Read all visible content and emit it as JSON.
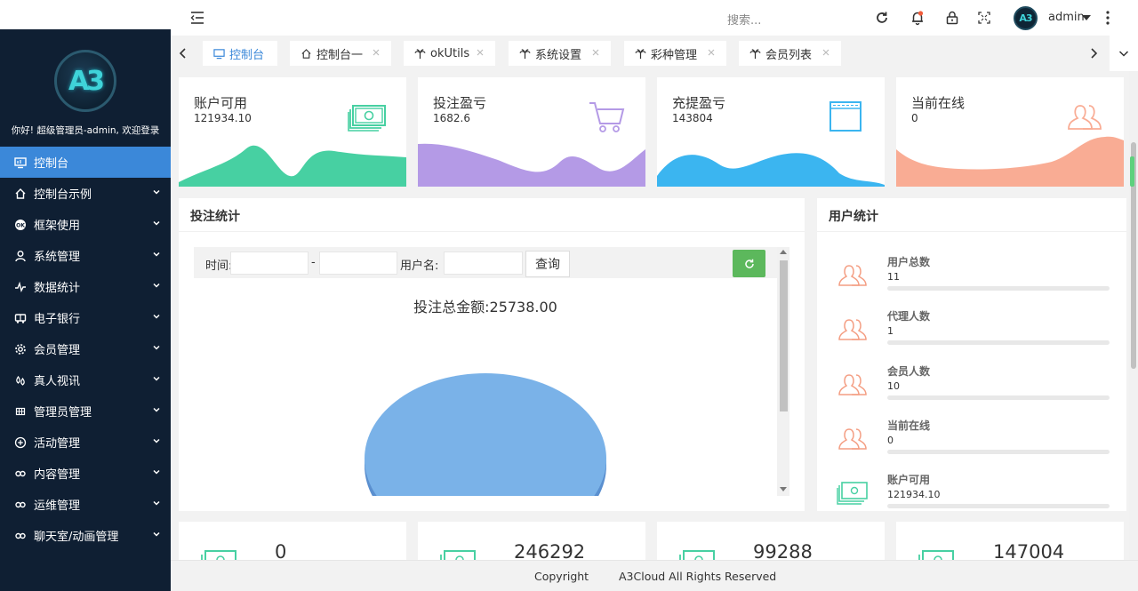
{
  "app": {
    "logo_text": "A3",
    "welcome": "你好! 超级管理员-admin, 欢迎登录"
  },
  "sidebar": {
    "items": [
      {
        "label": "控制台",
        "icon": "monitor-icon",
        "active": true
      },
      {
        "label": "控制台示例",
        "icon": "home-icon"
      },
      {
        "label": "框架使用",
        "icon": "ok-icon"
      },
      {
        "label": "系统管理",
        "icon": "user-icon"
      },
      {
        "label": "数据统计",
        "icon": "pulse-icon"
      },
      {
        "label": "电子银行",
        "icon": "bus-icon"
      },
      {
        "label": "会员管理",
        "icon": "gear-icon"
      },
      {
        "label": "真人视讯",
        "icon": "drops-icon"
      },
      {
        "label": "管理员管理",
        "icon": "grid-icon"
      },
      {
        "label": "活动管理",
        "icon": "plus-circle-icon"
      },
      {
        "label": "内容管理",
        "icon": "link-icon"
      },
      {
        "label": "运维管理",
        "icon": "link-icon"
      },
      {
        "label": "聊天室/动画管理",
        "icon": "link-icon"
      }
    ]
  },
  "header": {
    "search_placeholder": "搜索...",
    "username": "admin",
    "avatar_text": "A3"
  },
  "tabs": [
    {
      "label": "控制台",
      "icon": "monitor-icon",
      "active": true,
      "closable": false
    },
    {
      "label": "控制台一",
      "icon": "home-icon",
      "closable": true
    },
    {
      "label": "okUtils",
      "icon": "palm-icon",
      "closable": true
    },
    {
      "label": "系统设置",
      "icon": "palm-icon",
      "closable": true
    },
    {
      "label": "彩种管理",
      "icon": "palm-icon",
      "closable": true
    },
    {
      "label": "会员列表",
      "icon": "palm-icon",
      "closable": true
    }
  ],
  "stat_cards": [
    {
      "title": "账户可用",
      "value": "121934.10",
      "icon": "money-icon",
      "color": "#47d0a2"
    },
    {
      "title": "投注盈亏",
      "value": "1682.6",
      "icon": "cart-icon",
      "color": "#b49ae6"
    },
    {
      "title": "充提盈亏",
      "value": "143804",
      "icon": "browser-icon",
      "color": "#3bb5f0"
    },
    {
      "title": "当前在线",
      "value": "0",
      "icon": "users-icon",
      "color": "#f9ac94"
    }
  ],
  "bet_panel": {
    "title": "投注统计",
    "time_label": "时间:",
    "dash": "-",
    "user_label": "用户名:",
    "query_label": "查询",
    "total_text": "投注总金额:25738.00"
  },
  "user_panel": {
    "title": "用户统计",
    "rows": [
      {
        "label": "用户总数",
        "value": "11",
        "icon": "users-icon"
      },
      {
        "label": "代理人数",
        "value": "1",
        "icon": "users-icon"
      },
      {
        "label": "会员人数",
        "value": "10",
        "icon": "users-icon"
      },
      {
        "label": "当前在线",
        "value": "0",
        "icon": "users-icon"
      },
      {
        "label": "账户可用",
        "value": "121934.10",
        "icon": "money-icon"
      }
    ]
  },
  "bottom_cards": [
    {
      "value": "0"
    },
    {
      "value": "246292"
    },
    {
      "value": "99288"
    },
    {
      "value": "147004"
    }
  ],
  "footer": {
    "copyright": "Copyright",
    "company": "A3Cloud All Rights Reserved"
  },
  "colors": {
    "sidebar_bg": "#0f1f33",
    "active": "#3b88d9",
    "green_button": "#5cb85c"
  }
}
